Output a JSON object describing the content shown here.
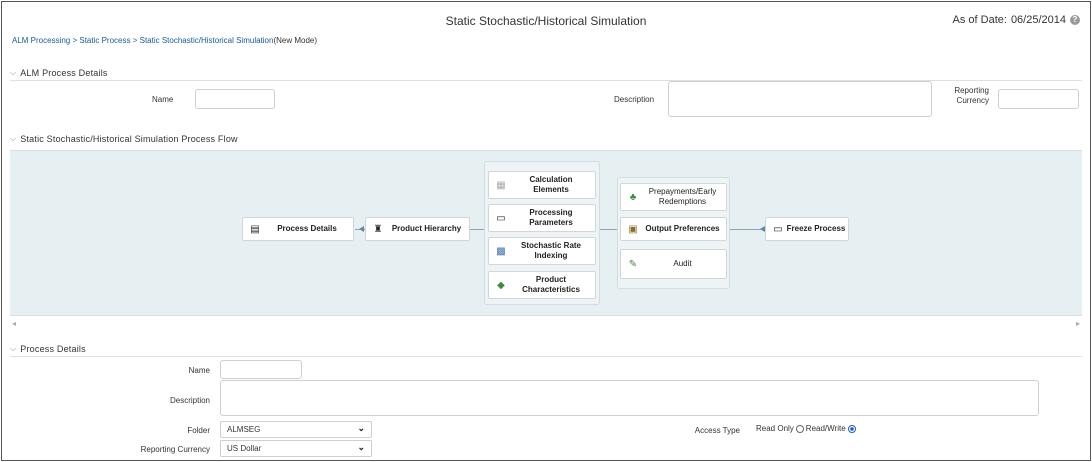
{
  "header": {
    "title": "Static Stochastic/Historical Simulation",
    "as_of_label": "As of Date:",
    "as_of_date": "06/25/2014",
    "help_icon_glyph": "?",
    "breadcrumb": "ALM Processing > Static Process > Static Stochastic/Historical Simulation",
    "breadcrumb_mode": "(New Mode)"
  },
  "alm_details": {
    "heading": "ALM Process Details",
    "name_label": "Name",
    "description_label": "Description",
    "reporting_currency_label_1": "Reporting",
    "reporting_currency_label_2": "Currency"
  },
  "process_flow": {
    "heading": "Static Stochastic/Historical Simulation Process Flow",
    "nodes": {
      "process_details": "Process Details",
      "product_hierarchy": "Product Hierarchy",
      "calculation_elements_1": "Calculation",
      "calculation_elements_2": "Elements",
      "processing_parameters_1": "Processing",
      "processing_parameters_2": "Parameters",
      "stochastic_rate_1": "Stochastic Rate",
      "stochastic_rate_2": "Indexing",
      "product_characteristics_1": "Product",
      "product_characteristics_2": "Characteristics",
      "prepayments_1": "Prepayments/Early",
      "prepayments_2": "Redemptions",
      "output_preferences": "Output Preferences",
      "audit": "Audit",
      "freeze_process": "Freeze Process"
    },
    "scroll_left": "◂",
    "scroll_right": "▸"
  },
  "process_details": {
    "heading": "Process Details",
    "name_label": "Name",
    "description_label": "Description",
    "folder_label": "Folder",
    "folder_value": "ALMSEG",
    "reporting_currency_label": "Reporting Currency",
    "reporting_currency_value": "US Dollar",
    "access_type_label": "Access Type",
    "read_only_label": "Read Only",
    "read_write_label": "Read/Write",
    "selected_access": "Read/Write"
  },
  "colors": {
    "accent": "#1c5ec9",
    "flow_background": "#e6eff1",
    "breadcrumb_link": "#1a5aa0"
  }
}
